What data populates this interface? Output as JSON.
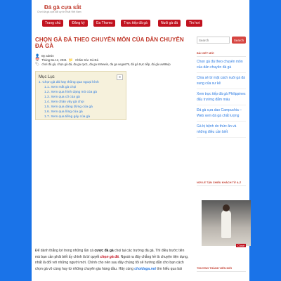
{
  "site": {
    "title": "Đá gà cựa sắt",
    "tagline": "Chơi đá gà cựa sắt uy tín nhất Việt Nam"
  },
  "nav": [
    "Trang chủ",
    "Đăng ký",
    "Ga Thomo",
    "Trực tiếp đá gà",
    "Nuôi gà đá",
    "Tin hot"
  ],
  "post": {
    "title": "CHỌN GÀ ĐÁ THEO CHUYÊN MÔN CỦA DÂN CHUYÊN ĐÁ GÀ",
    "author": "By admin",
    "date": "Tháng Ba 12, 2021",
    "category": "Chăm Sóc Gà Đá",
    "tags": "chơi đá gà, chọn gà đá, đa ga cpc1, đa ga m8wwin, đa ga vegas79, đá gà trực tiếp, đá gà uw88vip"
  },
  "toc": {
    "title": "Mục Lục",
    "toggle": "≡",
    "items": [
      "1. Chọn gà đá hay thông qua ngoại hình",
      "1.1. Xem mắt gà chọi",
      "1.2. Xem qua hình dạng mỏ của gà",
      "1.3. Xem qua cổ của gà",
      "1.4. Xem chân vảy gà chọi",
      "1.5. Xem qua dáng đứng của gà",
      "1.6. Xem qua lông của gà",
      "1.7. Xem qua tiếng gáy của gà"
    ]
  },
  "body": {
    "p1_a": "Để dành thắng lợi trong những lần cá ",
    "p1_b": "cược đá gà",
    "p1_c": " chọi tại các trường đá gà. Thì điều trước tiên mà bạn cần phải biết ấy chính là bí quyết ",
    "p1_d": "chọn gà đá",
    "p1_e": ". Ngoài ra đây chẳng hề là chuyện tiện dụng, nhất là đối với những người mới. Chính cho nên sau đây chúng tôi sẽ hướng dẫn cho bạn cách chọn gà vô",
    "p2_a": "cùng hay từ những chuyên gia hàng đầu. Hãy cùng ",
    "p2_b": "choidaga.net",
    "p2_c": " tìm hiểu qua bài"
  },
  "sidebar": {
    "search_placeholder": "Search",
    "search_button": "Search",
    "recent_title": "BÀI VIẾT MỚI",
    "recent_posts": [
      "Chọn gà đá theo chuyên môn của dân chuyên đá gà",
      "Chia sẻ bí mật cách nuôi gà đá sung của sư kê",
      "Xem trực tiếp đá gà Philippines đấu trường đẳm máu",
      "Đá gà cựa dao Campuchia – Web xem đá gà chất lượng",
      "Gà bị bệnh do thức ăn và những điều cần biết"
    ],
    "tags_title": "NƠI LỂ TẬN CHIẾU KHÁCH TỪ A-Z",
    "video_close": "Close",
    "footer_title": "THƯƠNG THÀNH VIÊN MỚI"
  }
}
